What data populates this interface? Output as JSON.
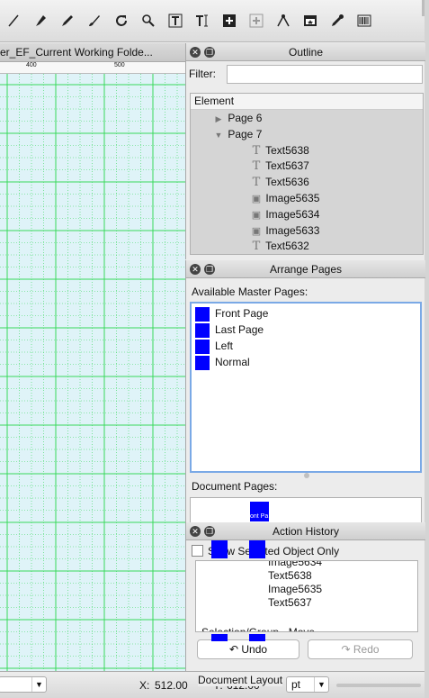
{
  "toolbar": {
    "tools": [
      "line-tool-icon",
      "bezier-pen-icon",
      "pencil-icon",
      "brush-icon",
      "refresh-icon",
      "zoom-icon",
      "text-frame-icon",
      "text-on-path-icon",
      "link-frames-icon",
      "unlink-frames-icon",
      "node-edit-icon",
      "table-insert-icon",
      "eyedropper-icon",
      "barcode-icon"
    ]
  },
  "document": {
    "tab_title": "er_EF_Current Working Folde...",
    "ruler_labels": [
      "400",
      "500"
    ]
  },
  "outline": {
    "title": "Outline",
    "filter_label": "Filter:",
    "filter_value": "",
    "column_header": "Element",
    "rows": [
      {
        "label": "Page 6",
        "kind": "page",
        "expanded": false
      },
      {
        "label": "Page 7",
        "kind": "page",
        "expanded": true
      },
      {
        "label": "Text5638",
        "kind": "text"
      },
      {
        "label": "Text5637",
        "kind": "text"
      },
      {
        "label": "Text5636",
        "kind": "text"
      },
      {
        "label": "Image5635",
        "kind": "image"
      },
      {
        "label": "Image5634",
        "kind": "image"
      },
      {
        "label": "Image5633",
        "kind": "image"
      },
      {
        "label": "Text5632",
        "kind": "text"
      }
    ]
  },
  "arrange": {
    "title": "Arrange Pages",
    "master_label": "Available Master Pages:",
    "master_pages": [
      "Front Page",
      "Last Page",
      "Left",
      "Normal"
    ],
    "document_pages_label": "Document Pages:",
    "thumb_caption": "ont Pa",
    "document_layout_label": "Document Layout"
  },
  "history": {
    "title": "Action History",
    "show_selected_label": "Show Selected Object Only",
    "show_selected_checked": false,
    "items": [
      "Image5634",
      "Text5638",
      "Image5635",
      "Text5637"
    ],
    "group_label": "Selection/Group - Move",
    "undo_label": "Undo",
    "redo_label": "Redo"
  },
  "status": {
    "x_label": "X:",
    "x_value": "512.00",
    "y_label": "Y:",
    "y_value": "612.00",
    "unit": "pt"
  },
  "colors": {
    "grid_green": "#38d95b",
    "canvas_bg": "#dff3f8",
    "master_swatch": "#0000ff",
    "focus_ring": "#7aa9e6"
  }
}
